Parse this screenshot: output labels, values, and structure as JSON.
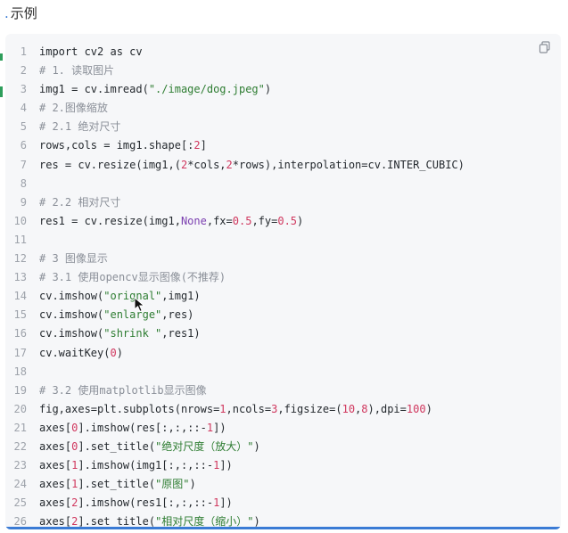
{
  "heading": {
    "prefix": ".",
    "title": "示例"
  },
  "copy_icon": "copy-icon",
  "colors": {
    "background": "#ffffff",
    "code_bg": "#f6f7f9",
    "comment": "#8a8f98",
    "string": "#2e7d32",
    "number": "#d0375e",
    "accent": "#3a7bd5",
    "marker": "#2e9e5b"
  },
  "code_lines": [
    [
      {
        "t": "import cv2 as cv",
        "c": "kw"
      }
    ],
    [
      {
        "t": "# 1. 读取图片",
        "c": "cm"
      }
    ],
    [
      {
        "t": "img1 = cv.imread(",
        "c": "code"
      },
      {
        "t": "\"./image/dog.jpeg\"",
        "c": "str"
      },
      {
        "t": ")",
        "c": "code"
      }
    ],
    [
      {
        "t": "# 2.图像缩放",
        "c": "cm"
      }
    ],
    [
      {
        "t": "# 2.1 绝对尺寸",
        "c": "cm"
      }
    ],
    [
      {
        "t": "rows,cols = img1.shape[:",
        "c": "code"
      },
      {
        "t": "2",
        "c": "num"
      },
      {
        "t": "]",
        "c": "code"
      }
    ],
    [
      {
        "t": "res = cv.resize(img1,(",
        "c": "code"
      },
      {
        "t": "2",
        "c": "num"
      },
      {
        "t": "*cols,",
        "c": "code"
      },
      {
        "t": "2",
        "c": "num"
      },
      {
        "t": "*rows),interpolation=cv.INTER_CUBIC)",
        "c": "code"
      }
    ],
    [],
    [
      {
        "t": "# 2.2 相对尺寸",
        "c": "cm"
      }
    ],
    [
      {
        "t": "res1 = cv.resize(img1,",
        "c": "code"
      },
      {
        "t": "None",
        "c": "const"
      },
      {
        "t": ",fx=",
        "c": "code"
      },
      {
        "t": "0.5",
        "c": "num"
      },
      {
        "t": ",fy=",
        "c": "code"
      },
      {
        "t": "0.5",
        "c": "num"
      },
      {
        "t": ")",
        "c": "code"
      }
    ],
    [],
    [
      {
        "t": "# 3 图像显示",
        "c": "cm"
      }
    ],
    [
      {
        "t": "# 3.1 使用opencv显示图像(不推荐)",
        "c": "cm"
      }
    ],
    [
      {
        "t": "cv.imshow(",
        "c": "code"
      },
      {
        "t": "\"orignal\"",
        "c": "str"
      },
      {
        "t": ",img1)",
        "c": "code"
      }
    ],
    [
      {
        "t": "cv.imshow(",
        "c": "code"
      },
      {
        "t": "\"enlarge\"",
        "c": "str"
      },
      {
        "t": ",res)",
        "c": "code"
      }
    ],
    [
      {
        "t": "cv.imshow(",
        "c": "code"
      },
      {
        "t": "\"shrink \"",
        "c": "str"
      },
      {
        "t": ",res1)",
        "c": "code"
      }
    ],
    [
      {
        "t": "cv.waitKey(",
        "c": "code"
      },
      {
        "t": "0",
        "c": "num"
      },
      {
        "t": ")",
        "c": "code"
      }
    ],
    [],
    [
      {
        "t": "# 3.2 使用matplotlib显示图像",
        "c": "cm"
      }
    ],
    [
      {
        "t": "fig,axes=plt.subplots(nrows=",
        "c": "code"
      },
      {
        "t": "1",
        "c": "num"
      },
      {
        "t": ",ncols=",
        "c": "code"
      },
      {
        "t": "3",
        "c": "num"
      },
      {
        "t": ",figsize=(",
        "c": "code"
      },
      {
        "t": "10",
        "c": "num"
      },
      {
        "t": ",",
        "c": "code"
      },
      {
        "t": "8",
        "c": "num"
      },
      {
        "t": "),dpi=",
        "c": "code"
      },
      {
        "t": "100",
        "c": "num"
      },
      {
        "t": ")",
        "c": "code"
      }
    ],
    [
      {
        "t": "axes[",
        "c": "code"
      },
      {
        "t": "0",
        "c": "num"
      },
      {
        "t": "].imshow(res[:,:,::-",
        "c": "code"
      },
      {
        "t": "1",
        "c": "num"
      },
      {
        "t": "])",
        "c": "code"
      }
    ],
    [
      {
        "t": "axes[",
        "c": "code"
      },
      {
        "t": "0",
        "c": "num"
      },
      {
        "t": "].set_title(",
        "c": "code"
      },
      {
        "t": "\"绝对尺度（放大）\"",
        "c": "str"
      },
      {
        "t": ")",
        "c": "code"
      }
    ],
    [
      {
        "t": "axes[",
        "c": "code"
      },
      {
        "t": "1",
        "c": "num"
      },
      {
        "t": "].imshow(img1[:,:,::-",
        "c": "code"
      },
      {
        "t": "1",
        "c": "num"
      },
      {
        "t": "])",
        "c": "code"
      }
    ],
    [
      {
        "t": "axes[",
        "c": "code"
      },
      {
        "t": "1",
        "c": "num"
      },
      {
        "t": "].set_title(",
        "c": "code"
      },
      {
        "t": "\"原图\"",
        "c": "str"
      },
      {
        "t": ")",
        "c": "code"
      }
    ],
    [
      {
        "t": "axes[",
        "c": "code"
      },
      {
        "t": "2",
        "c": "num"
      },
      {
        "t": "].imshow(res1[:,:,::-",
        "c": "code"
      },
      {
        "t": "1",
        "c": "num"
      },
      {
        "t": "])",
        "c": "code"
      }
    ],
    [
      {
        "t": "axes[",
        "c": "code"
      },
      {
        "t": "2",
        "c": "num"
      },
      {
        "t": "].set_title(",
        "c": "code"
      },
      {
        "t": "\"相对尺度（缩小）\"",
        "c": "str"
      },
      {
        "t": ")",
        "c": "code"
      }
    ]
  ]
}
